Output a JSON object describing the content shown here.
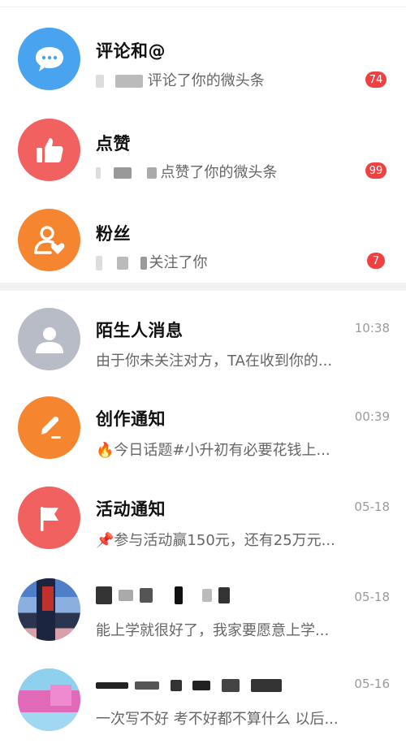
{
  "interactions": [
    {
      "title": "评论和@",
      "text": "评论了你的微头条",
      "badge": "74",
      "color": "#4aa3ee",
      "icon": "chat-bubble-icon"
    },
    {
      "title": "点赞",
      "text": "点赞了你的微头条",
      "badge": "99",
      "color": "#f0615f",
      "icon": "thumbs-up-icon"
    },
    {
      "title": "粉丝",
      "text": "关注了你",
      "badge": "7",
      "color": "#f5852f",
      "icon": "fan-person-heart-icon"
    }
  ],
  "messages": [
    {
      "title": "陌生人消息",
      "preview": "由于你未关注对方，TA在收到你的...",
      "time": "10:38",
      "color": "#b8bcc7",
      "icon": "person-icon"
    },
    {
      "title": "创作通知",
      "preview": "🔥今日话题#小升初有必要花钱上...",
      "time": "00:39",
      "color": "#f5852f",
      "icon": "pencil-icon"
    },
    {
      "title": "活动通知",
      "preview": "📌参与活动赢150元，还有25万元...",
      "time": "05-18",
      "color": "#f0615f",
      "icon": "flag-icon"
    },
    {
      "title": "",
      "preview": "能上学就很好了，我家要愿意上学...",
      "time": "05-18"
    },
    {
      "title": "",
      "preview": "一次写不好 考不好都不算什么 以后...",
      "time": "05-16"
    }
  ]
}
